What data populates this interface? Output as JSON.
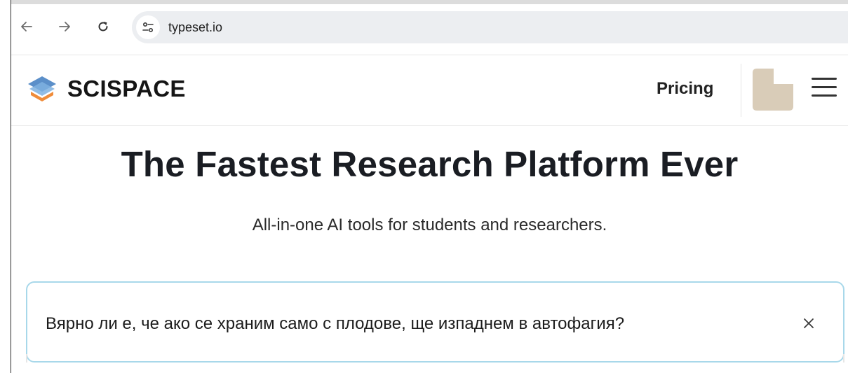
{
  "browser": {
    "url": "typeset.io",
    "back_icon": "arrow-left-icon",
    "forward_icon": "arrow-right-icon",
    "reload_icon": "reload-icon",
    "site_info_icon": "tune-icon"
  },
  "header": {
    "brand": "SCISPACE",
    "pricing_label": "Pricing",
    "menu_icon": "hamburger-menu-icon",
    "colors": {
      "logo_blue": "#5b8fc9",
      "logo_orange": "#f08c3a",
      "avatar_bg": "#d9ccb8"
    }
  },
  "hero": {
    "title": "The Fastest Research Platform Ever",
    "subtitle": "All-in-one AI tools for students and researchers."
  },
  "search": {
    "query": "Вярно ли е, че ако се храним само с плодове, ще изпаднем в автофагия?",
    "clear_icon": "close-icon",
    "border_color": "#a8d8ea"
  }
}
